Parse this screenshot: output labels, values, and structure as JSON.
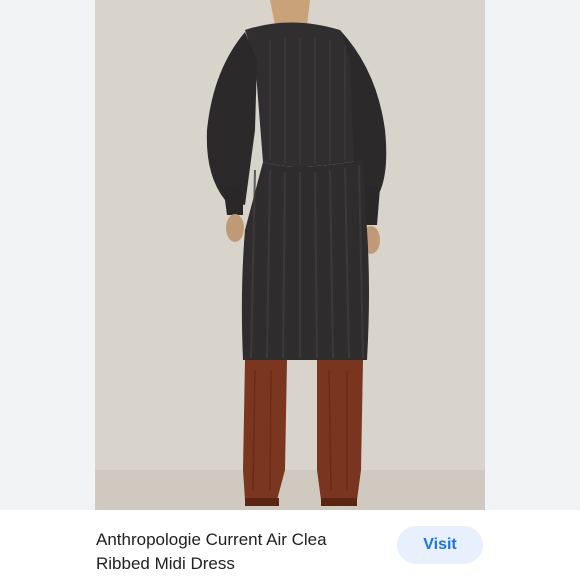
{
  "product": {
    "title": "Anthropologie Current Air Clea\nRibbed Midi Dress",
    "image_alt": "Woman from behind wearing dark charcoal ribbed sweater with balloon sleeves and ribbed midi skirt with brown croc-embossed knee-high boots"
  },
  "actions": {
    "visit_label": "Visit"
  },
  "colors": {
    "background": "#d7d2ca",
    "garment": "#2f2c2d",
    "boots": "#7a3520",
    "button_bg": "#e8f0fe",
    "button_text": "#1a73e8"
  }
}
